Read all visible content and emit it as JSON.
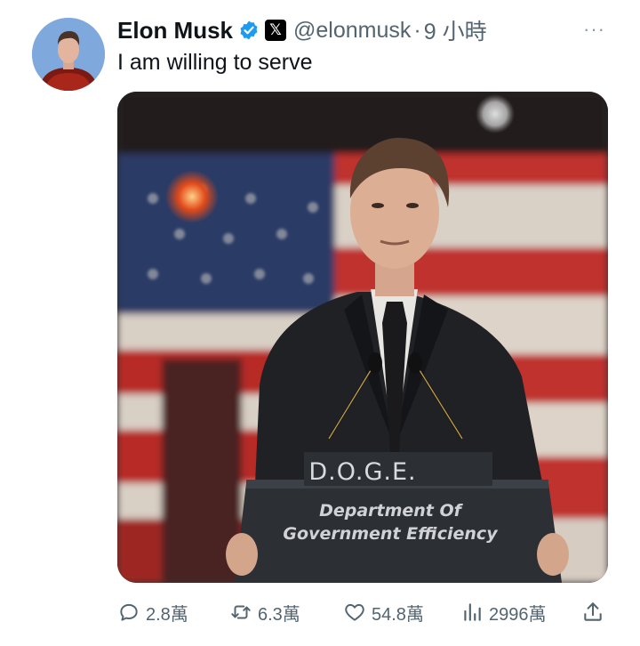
{
  "author": {
    "display_name": "Elon Musk",
    "handle": "@elonmusk",
    "separator": "·",
    "time": "9 小時",
    "verified": true,
    "affiliate_badge": "𝕏"
  },
  "more_menu": "···",
  "tweet": {
    "text": "I am willing to serve"
  },
  "media": {
    "podium_top_label": "D.O.G.E.",
    "podium_line1": "Department Of",
    "podium_line2": "Government Efficiency"
  },
  "actions": {
    "replies": "2.8萬",
    "retweets": "6.3萬",
    "likes": "54.8萬",
    "views": "2996萬"
  },
  "colors": {
    "text_primary": "#0f1419",
    "text_secondary": "#536471",
    "verified_blue": "#1d9bf0"
  },
  "icons": {
    "verified": "verified-badge-icon",
    "reply": "reply-icon",
    "retweet": "retweet-icon",
    "like": "heart-icon",
    "views": "views-chart-icon",
    "share": "share-icon"
  }
}
